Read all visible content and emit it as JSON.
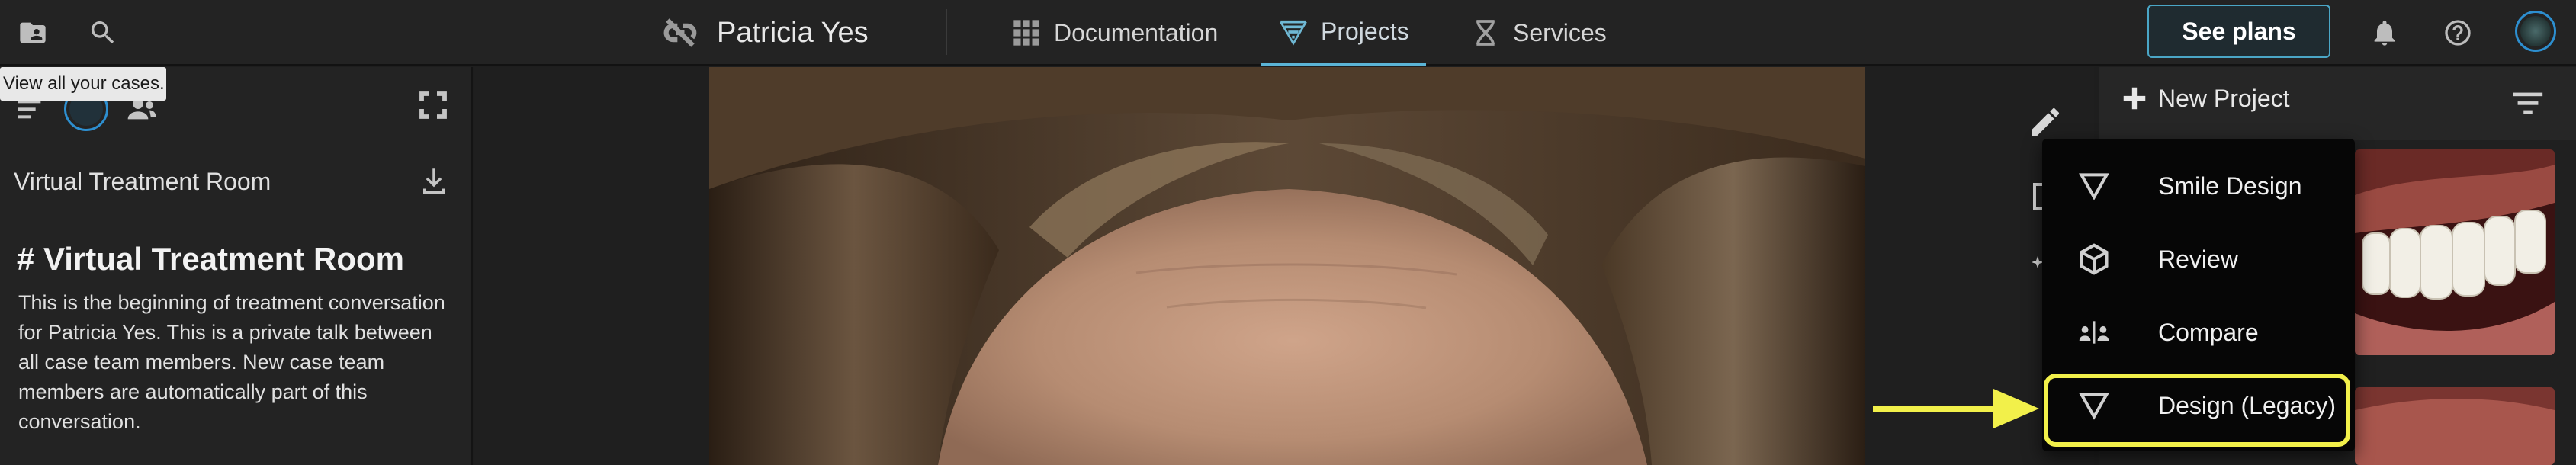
{
  "topbar": {
    "patient_name": "Patricia Yes",
    "nav": [
      {
        "label": "Documentation",
        "icon": "grid-icon"
      },
      {
        "label": "Projects",
        "icon": "projects-icon"
      },
      {
        "label": "Services",
        "icon": "services-icon"
      }
    ],
    "see_plans_label": "See plans",
    "icons": [
      "cases-folder-icon",
      "search-icon",
      "unlink-icon",
      "bell-icon",
      "help-icon",
      "avatar"
    ]
  },
  "tooltip": {
    "text": "View all your cases."
  },
  "left_panel": {
    "room_title": "Virtual Treatment Room",
    "heading": "# Virtual Treatment Room",
    "body": "This is the beginning of treatment conversation for Patricia Yes. This is a private talk between all case team members. New case team members are automatically part of this conversation."
  },
  "right_panel": {
    "new_project_label": "New Project"
  },
  "menu": {
    "items": [
      {
        "label": "Smile Design",
        "icon": "triangle-icon"
      },
      {
        "label": "Review",
        "icon": "cube-icon"
      },
      {
        "label": "Compare",
        "icon": "compare-icon"
      },
      {
        "label": "Design (Legacy)",
        "icon": "triangle-icon"
      }
    ],
    "highlighted_index": 3
  },
  "colors": {
    "accent": "#5bb4d6",
    "highlight": "#f2f04a",
    "background": "#1e1e1e"
  }
}
